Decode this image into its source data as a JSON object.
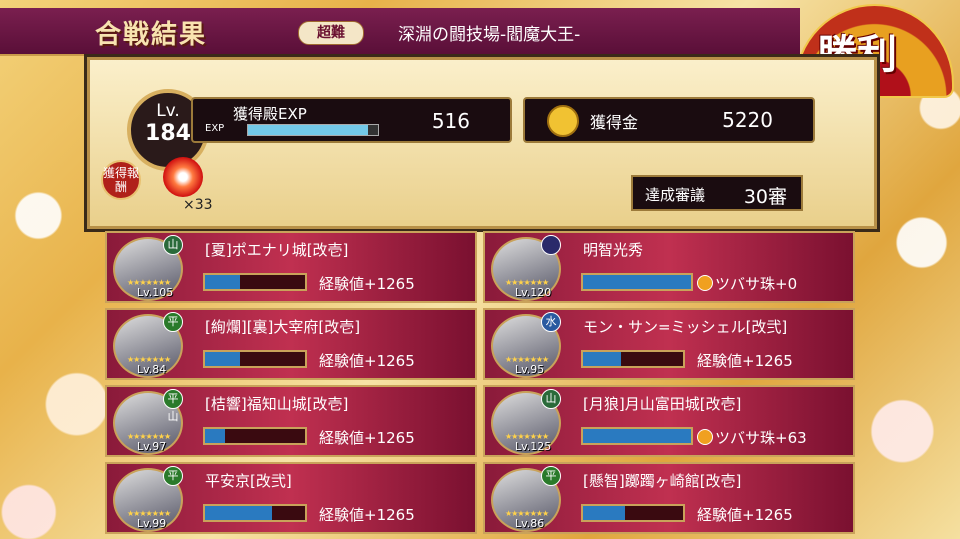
{
  "header": {
    "title": "合戦結果",
    "difficulty": "超難",
    "stage": "深淵の闘技場-閻魔大王-",
    "victory": "勝利"
  },
  "summary": {
    "level_label": "Lv.",
    "level": "184",
    "exp_label": "獲得殿EXP",
    "exp_value": "516",
    "exp_bar_label": "EXP",
    "exp_bar_fraction": 0.92,
    "gold_label": "獲得金",
    "gold_value": "5220",
    "reward_label": "獲得報酬",
    "reward_qty": "×33",
    "achieve_label": "達成審議",
    "achieve_value": "30審"
  },
  "characters": [
    {
      "name": "[夏]ポエナリ城[改壱]",
      "level": "Lv.105",
      "element": "山",
      "element_color": "#2a6a3a",
      "exp_fraction": 0.35,
      "reward": "経験値+1265",
      "type": "exp"
    },
    {
      "name": "明智光秀",
      "level": "Lv.120",
      "element": "",
      "element_color": "#2a2a6a",
      "exp_fraction": 1.0,
      "reward": "ツバサ珠+0",
      "type": "gem"
    },
    {
      "name": "[絢爛][裏]大宰府[改壱]",
      "level": "Lv.84",
      "element": "平",
      "element_color": "#2a7a2a",
      "exp_fraction": 0.35,
      "reward": "経験値+1265",
      "type": "exp"
    },
    {
      "name": "モン・サン=ミッシェル[改弐]",
      "level": "Lv.95",
      "element": "水",
      "element_color": "#2a5aa0",
      "exp_fraction": 0.38,
      "reward": "経験値+1265",
      "type": "exp"
    },
    {
      "name": "[桔響]福知山城[改壱]",
      "level": "Lv.97",
      "element": "平山",
      "element_color": "#2a7a2a",
      "exp_fraction": 0.2,
      "reward": "経験値+1265",
      "type": "exp"
    },
    {
      "name": "[月狼]月山富田城[改壱]",
      "level": "Lv.125",
      "element": "山",
      "element_color": "#2a6a3a",
      "exp_fraction": 1.0,
      "reward": "ツバサ珠+63",
      "type": "gem"
    },
    {
      "name": "平安京[改弐]",
      "level": "Lv.99",
      "element": "平",
      "element_color": "#2a7a2a",
      "exp_fraction": 0.67,
      "reward": "経験値+1265",
      "type": "exp"
    },
    {
      "name": "[懸智]躑躅ヶ崎館[改壱]",
      "level": "Lv.86",
      "element": "平",
      "element_color": "#2a7a2a",
      "exp_fraction": 0.42,
      "reward": "経験値+1265",
      "type": "exp"
    }
  ]
}
